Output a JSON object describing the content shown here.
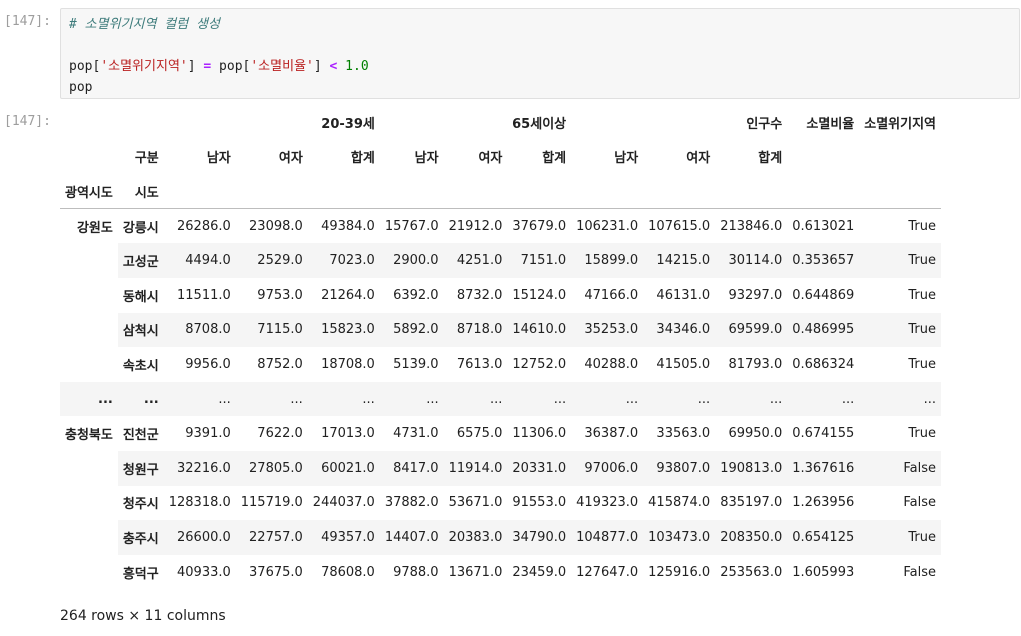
{
  "cell_in_prompt": "[147]:",
  "cell_out_prompt": "[147]:",
  "code": {
    "comment": "# 소멸위기지역 컬럼 생성",
    "line2": {
      "var1": "pop[",
      "key1": "'소멸위기지역'",
      "close1": "]",
      "eq": "=",
      "var2": "pop[",
      "key2": "'소멸비율'",
      "close2": "]",
      "lt": "<",
      "num": "1.0"
    },
    "line3": "pop"
  },
  "table": {
    "header_row1": [
      "",
      "",
      "20-39세",
      "",
      "",
      "65세이상",
      "",
      "",
      "",
      "인구수",
      "소멸비율",
      "소멸위기지역"
    ],
    "header_row2": [
      "",
      "구분",
      "남자",
      "여자",
      "합계",
      "남자",
      "여자",
      "합계",
      "남자",
      "여자",
      "합계",
      "",
      ""
    ],
    "header_row3": [
      "광역시도",
      "시도"
    ],
    "rows": [
      {
        "l1": "강원도",
        "l2": "강릉시",
        "v": [
          "26286.0",
          "23098.0",
          "49384.0",
          "15767.0",
          "21912.0",
          "37679.0",
          "106231.0",
          "107615.0",
          "213846.0",
          "0.613021",
          "True"
        ]
      },
      {
        "l1": "",
        "l2": "고성군",
        "v": [
          "4494.0",
          "2529.0",
          "7023.0",
          "2900.0",
          "4251.0",
          "7151.0",
          "15899.0",
          "14215.0",
          "30114.0",
          "0.353657",
          "True"
        ]
      },
      {
        "l1": "",
        "l2": "동해시",
        "v": [
          "11511.0",
          "9753.0",
          "21264.0",
          "6392.0",
          "8732.0",
          "15124.0",
          "47166.0",
          "46131.0",
          "93297.0",
          "0.644869",
          "True"
        ]
      },
      {
        "l1": "",
        "l2": "삼척시",
        "v": [
          "8708.0",
          "7115.0",
          "15823.0",
          "5892.0",
          "8718.0",
          "14610.0",
          "35253.0",
          "34346.0",
          "69599.0",
          "0.486995",
          "True"
        ]
      },
      {
        "l1": "",
        "l2": "속초시",
        "v": [
          "9956.0",
          "8752.0",
          "18708.0",
          "5139.0",
          "7613.0",
          "12752.0",
          "40288.0",
          "41505.0",
          "81793.0",
          "0.686324",
          "True"
        ]
      },
      {
        "l1": "...",
        "l2": "...",
        "v": [
          "...",
          "...",
          "...",
          "...",
          "...",
          "...",
          "...",
          "...",
          "...",
          "...",
          "..."
        ]
      },
      {
        "l1": "충청북도",
        "l2": "진천군",
        "v": [
          "9391.0",
          "7622.0",
          "17013.0",
          "4731.0",
          "6575.0",
          "11306.0",
          "36387.0",
          "33563.0",
          "69950.0",
          "0.674155",
          "True"
        ]
      },
      {
        "l1": "",
        "l2": "청원구",
        "v": [
          "32216.0",
          "27805.0",
          "60021.0",
          "8417.0",
          "11914.0",
          "20331.0",
          "97006.0",
          "93807.0",
          "190813.0",
          "1.367616",
          "False"
        ]
      },
      {
        "l1": "",
        "l2": "청주시",
        "v": [
          "128318.0",
          "115719.0",
          "244037.0",
          "37882.0",
          "53671.0",
          "91553.0",
          "419323.0",
          "415874.0",
          "835197.0",
          "1.263956",
          "False"
        ]
      },
      {
        "l1": "",
        "l2": "충주시",
        "v": [
          "26600.0",
          "22757.0",
          "49357.0",
          "14407.0",
          "20383.0",
          "34790.0",
          "104877.0",
          "103473.0",
          "208350.0",
          "0.654125",
          "True"
        ]
      },
      {
        "l1": "",
        "l2": "흥덕구",
        "v": [
          "40933.0",
          "37675.0",
          "78608.0",
          "9788.0",
          "13671.0",
          "23459.0",
          "127647.0",
          "125916.0",
          "253563.0",
          "1.605993",
          "False"
        ]
      }
    ]
  },
  "footer": "264 rows × 11 columns"
}
